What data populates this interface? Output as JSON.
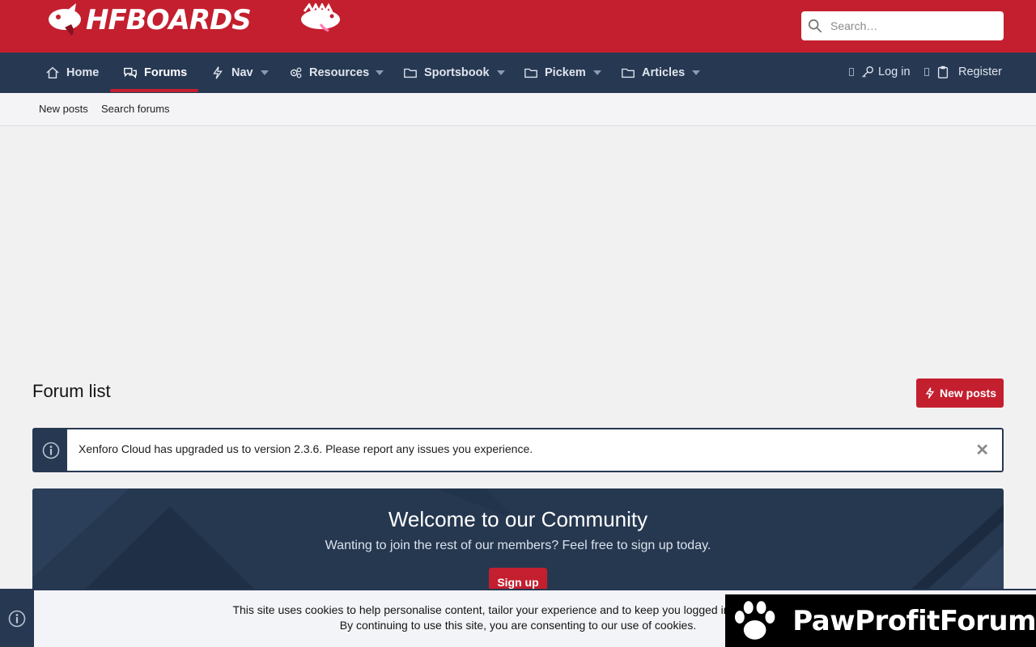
{
  "header": {
    "logo_text": "HFBOARDS",
    "search": {
      "placeholder": "Search…"
    }
  },
  "nav": {
    "items": [
      {
        "label": "Home",
        "icon": "home-icon"
      },
      {
        "label": "Forums",
        "icon": "forums-icon",
        "active": true
      },
      {
        "label": "Nav",
        "icon": "bolt-icon",
        "has_dropdown": true
      },
      {
        "label": "Resources",
        "icon": "cogs-icon",
        "has_dropdown": true
      },
      {
        "label": "Sportsbook",
        "icon": "folder-icon",
        "has_dropdown": true
      },
      {
        "label": "Pickem",
        "icon": "folder-icon",
        "has_dropdown": true
      },
      {
        "label": "Articles",
        "icon": "folder-icon",
        "has_dropdown": true
      }
    ],
    "login_label": "Log in",
    "register_label": "Register"
  },
  "subnav": {
    "new_posts": "New posts",
    "search_forums": "Search forums"
  },
  "main": {
    "title": "Forum list",
    "new_posts_button": "New posts",
    "notice": "Xenforo Cloud has upgraded us to version 2.3.6. Please report any issues you experience.",
    "notice_close": "✕"
  },
  "welcome": {
    "title": "Welcome to our Community",
    "subtitle": "Wanting to join the rest of our members? Feel free to sign up today.",
    "signup": "Sign up"
  },
  "cookie": {
    "line1": "This site uses cookies to help personalise content, tailor your experience and to keep you logged in if you register.",
    "line2": "By continuing to use this site, you are consenting to our use of cookies."
  },
  "watermark": {
    "text": "PawProfitForum"
  },
  "colors": {
    "brand_red": "#c41f2f",
    "nav_navy": "#273852"
  }
}
